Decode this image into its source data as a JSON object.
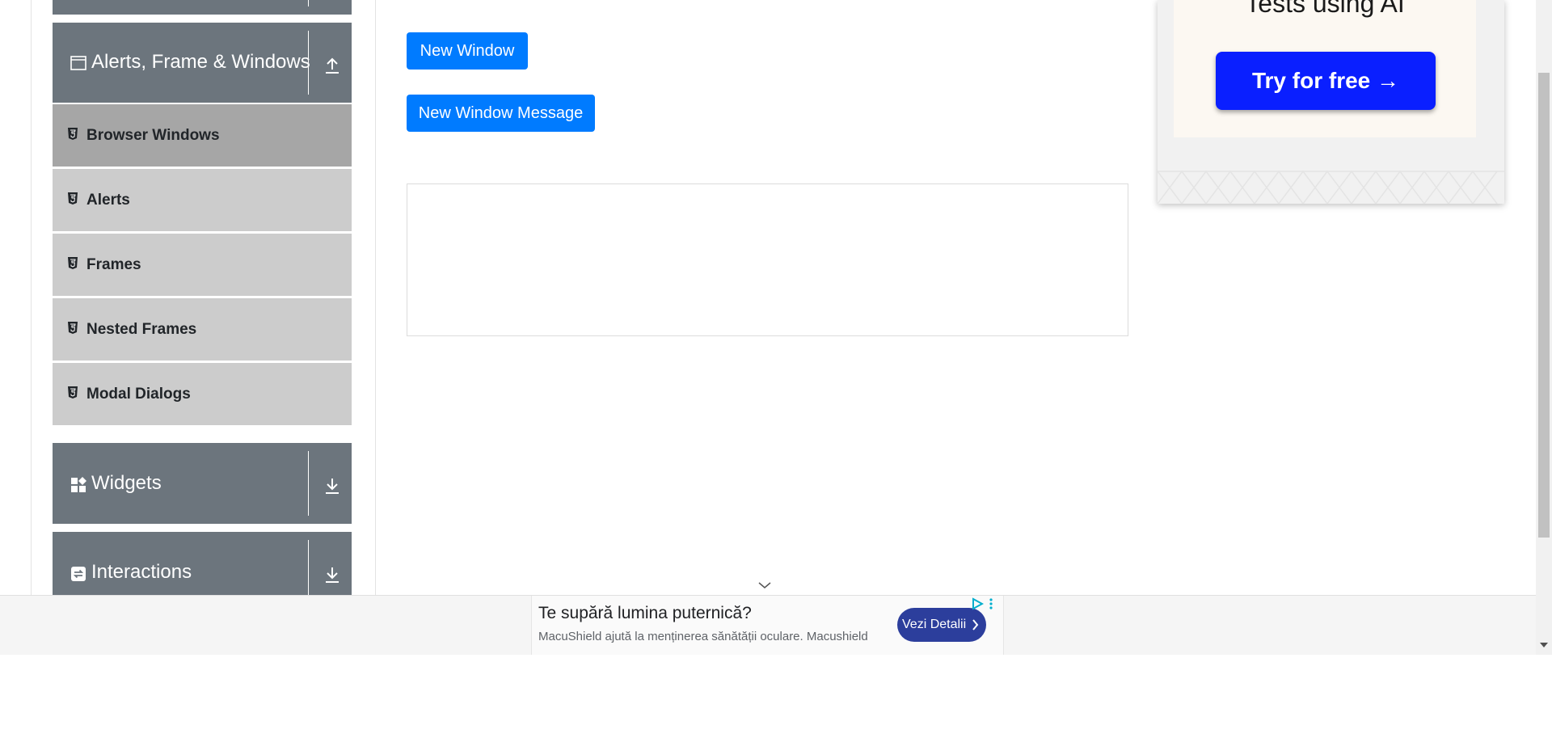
{
  "sidebar": {
    "group_alerts": {
      "label": "Alerts, Frame & Windows",
      "icon": "window-icon",
      "toggle_icon": "collapse-up-icon"
    },
    "items": [
      {
        "label": "Browser Windows",
        "icon": "html5-icon",
        "active": true
      },
      {
        "label": "Alerts",
        "icon": "html5-icon",
        "active": false
      },
      {
        "label": "Frames",
        "icon": "html5-icon",
        "active": false
      },
      {
        "label": "Nested Frames",
        "icon": "html5-icon",
        "active": false
      },
      {
        "label": "Modal Dialogs",
        "icon": "html5-icon",
        "active": false
      }
    ],
    "group_widgets": {
      "label": "Widgets",
      "icon": "widgets-icon",
      "toggle_icon": "expand-down-icon"
    },
    "group_interactions": {
      "label": "Interactions",
      "icon": "interactions-icon",
      "toggle_icon": "expand-down-icon"
    }
  },
  "main": {
    "buttons": {
      "new_window": "New Window",
      "new_window_message": "New Window Message"
    }
  },
  "ad_right": {
    "headline": "Tests using AI",
    "cta": "Try for free →"
  },
  "ad_bottom": {
    "title": "Te supără lumina puternică?",
    "subtitle": "MacuShield ajută la menținerea sănătății oculare. Macushield",
    "cta": "Vezi Detalii"
  },
  "colors": {
    "primary": "#007bff",
    "sidebar_group": "#6c757d",
    "sidebar_item": "#cccccc",
    "sidebar_item_active": "#a6a6a6",
    "ad_cta": "#0a1fff"
  }
}
